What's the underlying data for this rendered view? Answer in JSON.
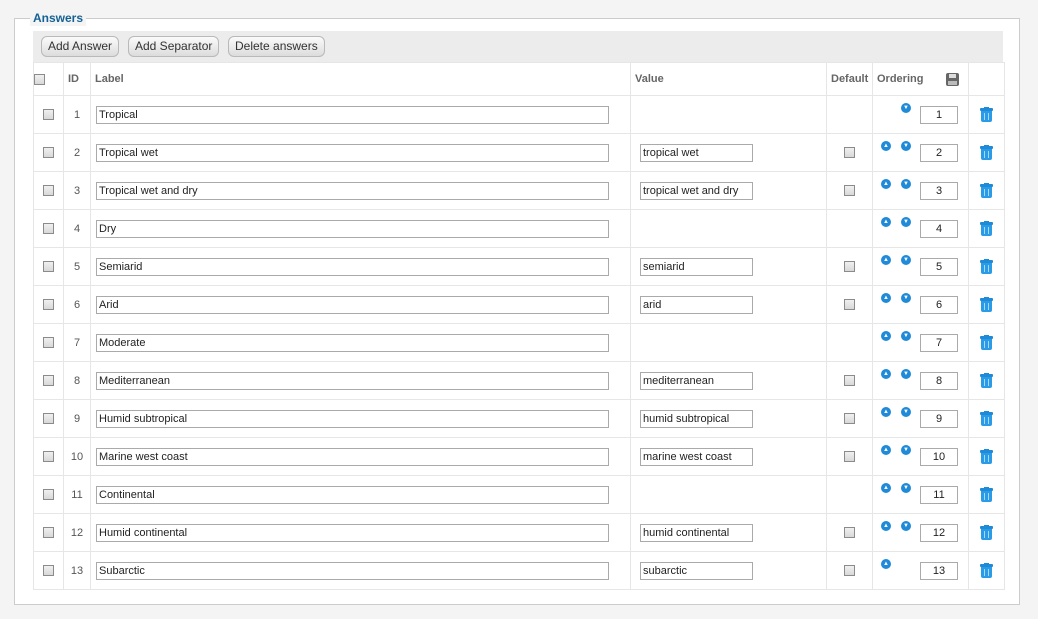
{
  "fieldset": {
    "legend": "Answers"
  },
  "toolbar": {
    "add_answer": "Add Answer",
    "add_separator": "Add Separator",
    "delete_answers": "Delete answers"
  },
  "columns": {
    "id": "ID",
    "label": "Label",
    "value": "Value",
    "default": "Default",
    "ordering": "Ordering"
  },
  "icons": {
    "move_up": "arrow-up-icon",
    "move_down": "arrow-down-icon",
    "delete": "trash-icon",
    "save_order": "save-icon"
  },
  "colors": {
    "accent": "#146295",
    "icon_blue": "#1f8ad8"
  },
  "rows": [
    {
      "id": "1",
      "label": "Tropical",
      "value": null,
      "has_default": false,
      "order": "1",
      "up": false,
      "down": true
    },
    {
      "id": "2",
      "label": "Tropical wet",
      "value": "tropical wet",
      "has_default": true,
      "order": "2",
      "up": true,
      "down": true
    },
    {
      "id": "3",
      "label": "Tropical wet and dry",
      "value": "tropical wet and dry",
      "has_default": true,
      "order": "3",
      "up": true,
      "down": true
    },
    {
      "id": "4",
      "label": "Dry",
      "value": null,
      "has_default": false,
      "order": "4",
      "up": true,
      "down": true
    },
    {
      "id": "5",
      "label": "Semiarid",
      "value": "semiarid",
      "has_default": true,
      "order": "5",
      "up": true,
      "down": true
    },
    {
      "id": "6",
      "label": "Arid",
      "value": "arid",
      "has_default": true,
      "order": "6",
      "up": true,
      "down": true
    },
    {
      "id": "7",
      "label": "Moderate",
      "value": null,
      "has_default": false,
      "order": "7",
      "up": true,
      "down": true
    },
    {
      "id": "8",
      "label": "Mediterranean",
      "value": "mediterranean",
      "has_default": true,
      "order": "8",
      "up": true,
      "down": true
    },
    {
      "id": "9",
      "label": "Humid subtropical",
      "value": "humid subtropical",
      "has_default": true,
      "order": "9",
      "up": true,
      "down": true
    },
    {
      "id": "10",
      "label": "Marine west coast",
      "value": "marine west coast",
      "has_default": true,
      "order": "10",
      "up": true,
      "down": true
    },
    {
      "id": "11",
      "label": "Continental",
      "value": null,
      "has_default": false,
      "order": "11",
      "up": true,
      "down": true
    },
    {
      "id": "12",
      "label": "Humid continental",
      "value": "humid continental",
      "has_default": true,
      "order": "12",
      "up": true,
      "down": true
    },
    {
      "id": "13",
      "label": "Subarctic",
      "value": "subarctic",
      "has_default": true,
      "order": "13",
      "up": true,
      "down": false
    }
  ]
}
